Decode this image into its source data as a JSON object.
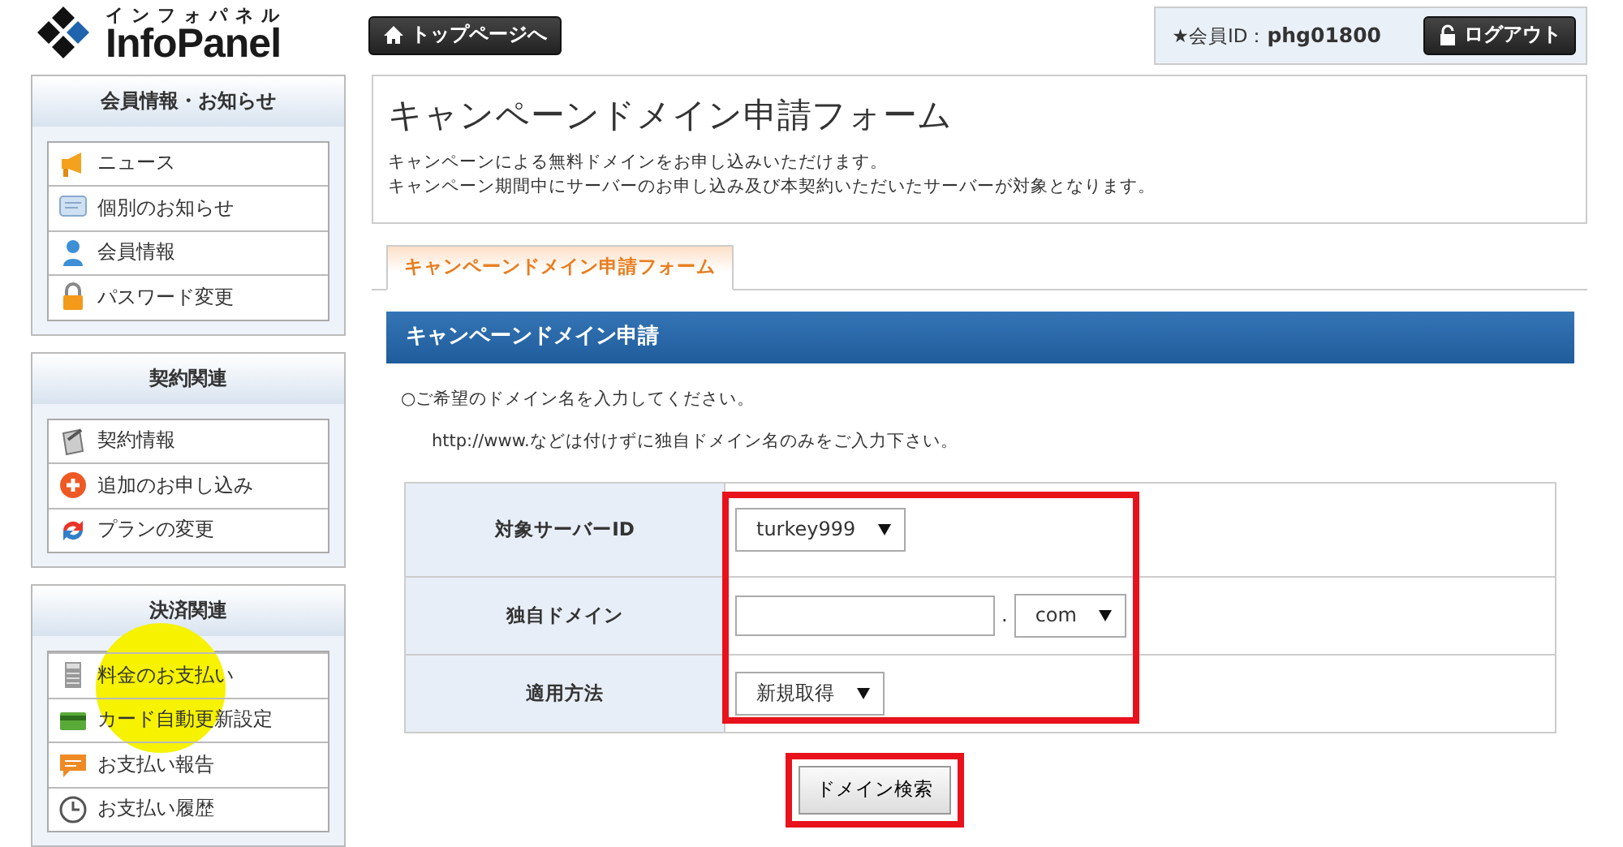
{
  "header": {
    "logo_kana": "インフォパネル",
    "logo_text": "InfoPanel",
    "top_button": "トップページへ",
    "member_id_label": "★会員ID：",
    "member_id": "phg01800",
    "logout_button": "ログアウト"
  },
  "sidebar": [
    {
      "title": "会員情報・お知らせ",
      "items": [
        {
          "label": "ニュース"
        },
        {
          "label": "個別のお知らせ"
        },
        {
          "label": "会員情報"
        },
        {
          "label": "パスワード変更"
        }
      ]
    },
    {
      "title": "契約関連",
      "items": [
        {
          "label": "契約情報"
        },
        {
          "label": "追加のお申し込み"
        },
        {
          "label": "プランの変更"
        }
      ]
    },
    {
      "title": "決済関連",
      "items": [
        {
          "label": "料金のお支払い"
        },
        {
          "label": "カード自動更新設定"
        },
        {
          "label": "お支払い報告"
        },
        {
          "label": "お支払い履歴"
        }
      ]
    }
  ],
  "intro": {
    "title": "キャンペーンドメイン申請フォーム",
    "lines": [
      "キャンペーンによる無料ドメインをお申し込みいただけます。",
      "キャンペーン期間中にサーバーのお申し込み及び本契約いただいたサーバーが対象となります。"
    ]
  },
  "tabs": [
    {
      "label": "キャンペーンドメイン申請フォーム",
      "selected": true
    }
  ],
  "section_title": "キャンペーンドメイン申請",
  "instructions": [
    "○ご希望のドメイン名を入力してください。",
    "http://www.などは付けずに独自ドメイン名のみをご入力下さい。"
  ],
  "form": [
    {
      "label": "対象サーバーID",
      "kind": "select",
      "value": "turkey999"
    },
    {
      "label": "独自ドメイン",
      "kind": "domain",
      "separator": ".",
      "tld": "com"
    },
    {
      "label": "適用方法",
      "kind": "select",
      "value": "新規取得"
    }
  ],
  "submit_button": "ドメイン検索"
}
